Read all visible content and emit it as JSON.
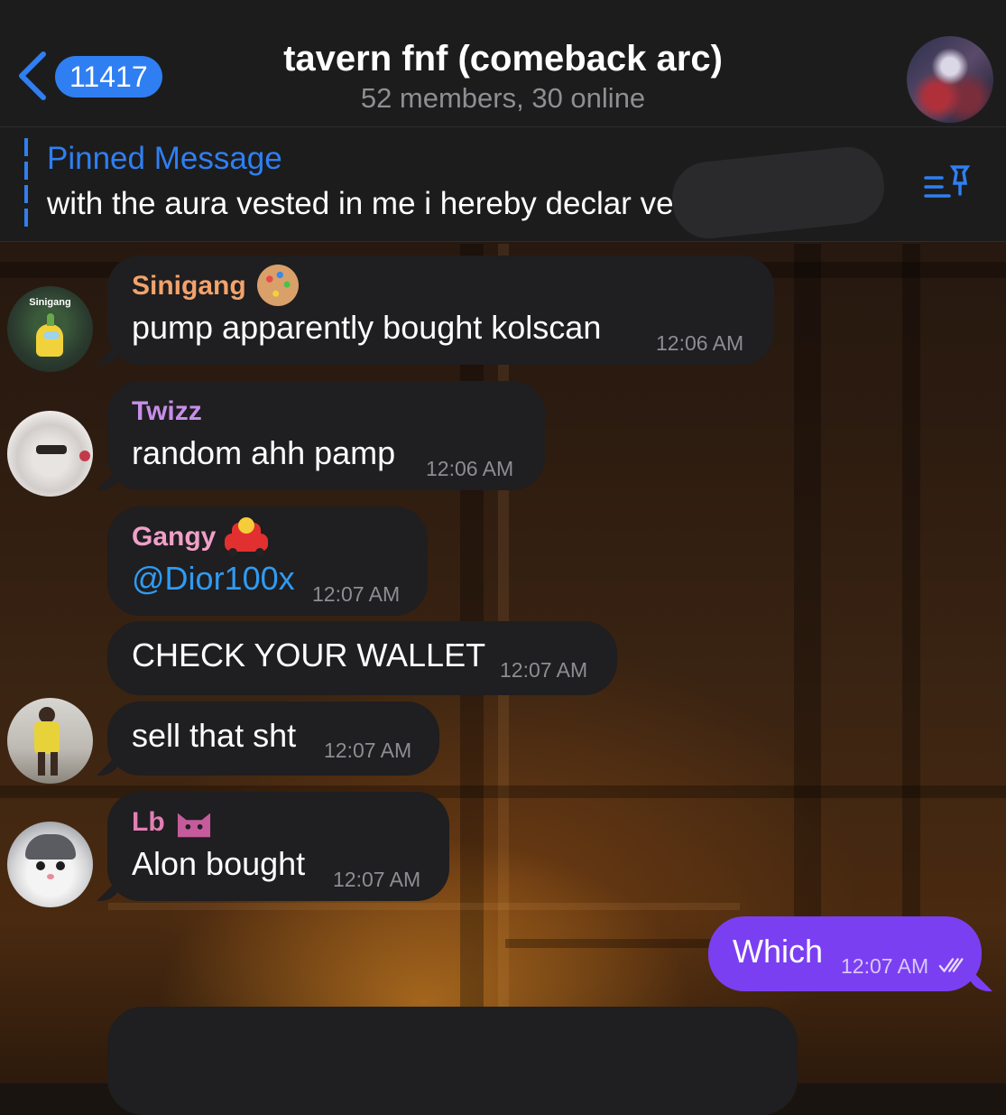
{
  "header": {
    "back_count": "11417",
    "title": "tavern fnf (comeback arc)",
    "subtitle": "52 members, 30 online"
  },
  "pinned": {
    "title": "Pinned Message",
    "text": "with the aura vested in me i hereby declar                      ver..."
  },
  "messages": [
    {
      "sender": "Sinigang",
      "sender_color": "#f2a36b",
      "text": "pump apparently bought kolscan",
      "time": "12:06 AM",
      "avatar_label": "Sinigang"
    },
    {
      "sender": "Twizz",
      "sender_color": "#c78ee8",
      "text": "random ahh pamp",
      "time": "12:06 AM"
    },
    {
      "sender": "Gangy",
      "sender_color": "#f0a0c8",
      "text": "@Dior100x",
      "time": "12:07 AM"
    },
    {
      "text": "CHECK YOUR WALLET",
      "time": "12:07 AM"
    },
    {
      "text": "sell that sht",
      "time": "12:07 AM"
    },
    {
      "sender": "Lb",
      "sender_color": "#e27fb3",
      "text": "Alon bought",
      "time": "12:07 AM"
    }
  ],
  "outgoing": {
    "text": "Which",
    "time": "12:07 AM",
    "status": "read"
  }
}
